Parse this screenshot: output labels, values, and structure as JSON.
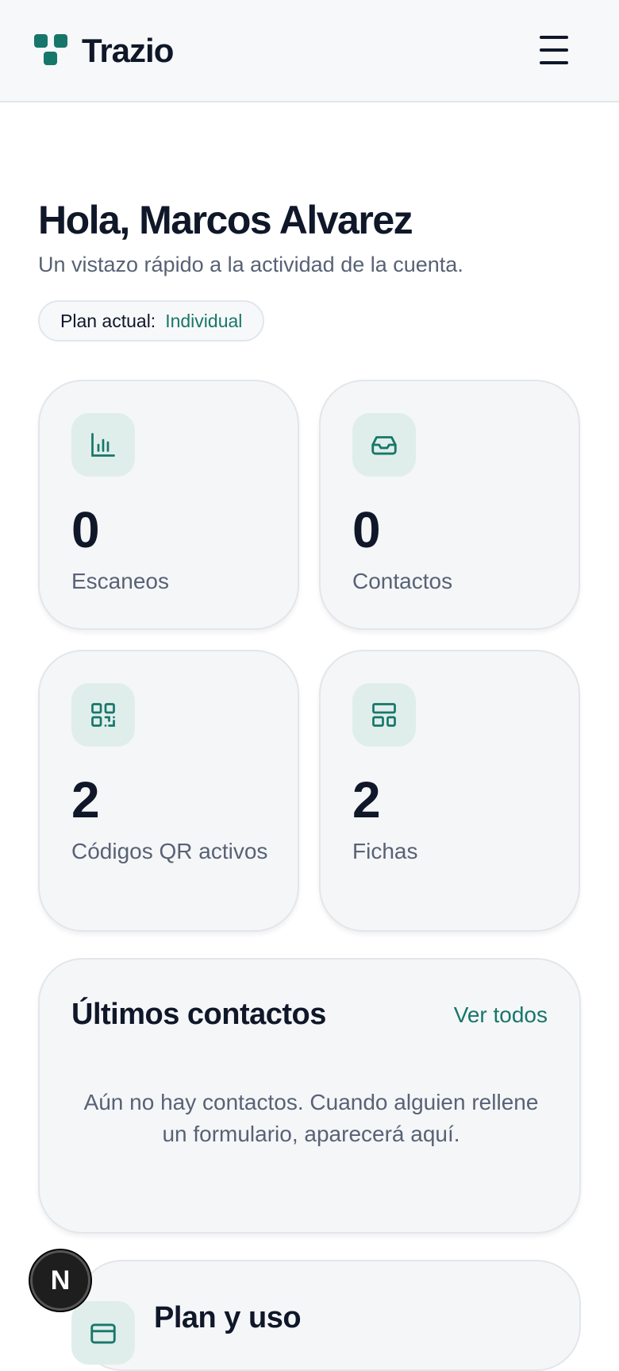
{
  "header": {
    "brand": "Trazio",
    "menu_icon": "hamburger-menu-icon"
  },
  "dashboard": {
    "greeting": "Hola, Marcos Alvarez",
    "subtitle": "Un vistazo rápido a la actividad de la cuenta.",
    "plan_label": "Plan actual:",
    "plan_value": "Individual"
  },
  "stats": [
    {
      "icon": "bar-chart-icon",
      "value": "0",
      "label": "Escaneos"
    },
    {
      "icon": "inbox-icon",
      "value": "0",
      "label": "Contactos"
    },
    {
      "icon": "qr-code-icon",
      "value": "2",
      "label": "Códigos QR activos"
    },
    {
      "icon": "layout-icon",
      "value": "2",
      "label": "Fichas"
    }
  ],
  "contacts": {
    "title": "Últimos contactos",
    "link": "Ver todos",
    "empty": "Aún no hay contactos. Cuando alguien rellene un formulario, aparecerá aquí."
  },
  "plan_usage": {
    "title": "Plan y uso",
    "icon": "credit-card-icon"
  },
  "dev_badge": {
    "letter": "N"
  },
  "colors": {
    "accent": "#17766a",
    "icon_bg": "#e0eeeb",
    "card_bg": "#f5f6f8",
    "text": "#0f1729",
    "muted": "#586275"
  }
}
